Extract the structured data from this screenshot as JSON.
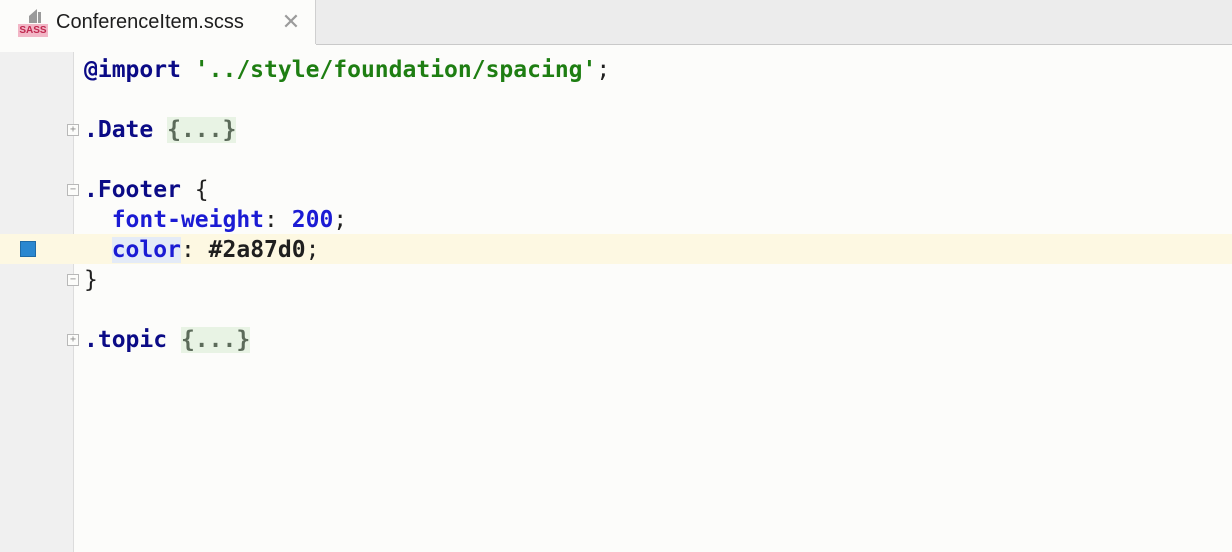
{
  "tab": {
    "filename": "ConferenceItem.scss",
    "badge": "SASS",
    "close_glyph": "✕",
    "icon": "sass-file-icon"
  },
  "code": {
    "line1": {
      "kw": "@import",
      "str": "'../style/foundation/spacing'",
      "end": ";"
    },
    "line2": {
      "selector": ".Date",
      "folded": "{...}"
    },
    "line3": {
      "selector": ".Footer",
      "brace": "{"
    },
    "line4": {
      "prop": "font-weight",
      "colon": ":",
      "value": "200",
      "end": ";"
    },
    "line5": {
      "prop": "color",
      "colon": ":",
      "value": "#2a87d0",
      "end": ";"
    },
    "line6": {
      "brace": "}"
    },
    "line7": {
      "selector": ".topic",
      "folded": "{...}"
    }
  },
  "colors": {
    "swatch": "#2a87d0",
    "current_line": "#fdf8e2"
  }
}
